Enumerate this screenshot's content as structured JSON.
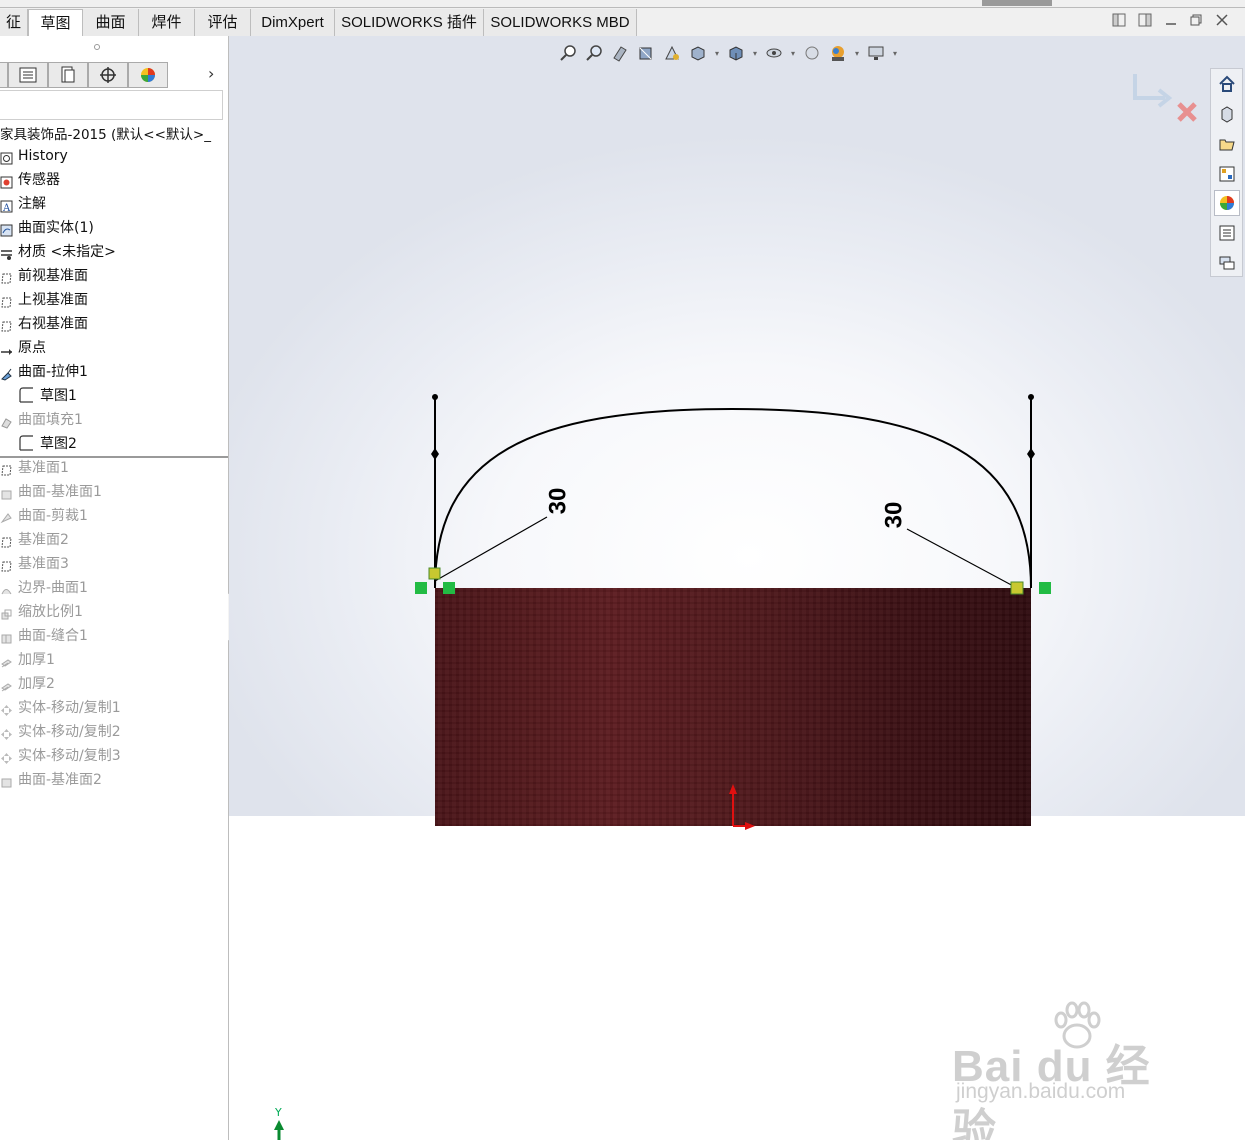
{
  "tabs": [
    {
      "label": "征",
      "active": false
    },
    {
      "label": "草图",
      "active": true
    },
    {
      "label": "曲面",
      "active": false
    },
    {
      "label": "焊件",
      "active": false
    },
    {
      "label": "评估",
      "active": false
    },
    {
      "label": "DimXpert",
      "active": false
    },
    {
      "label": "SOLIDWORKS 插件",
      "active": false
    },
    {
      "label": "SOLIDWORKS MBD",
      "active": false
    }
  ],
  "panel": {
    "root_label": "家具装饰品-2015  (默认<<默认>_",
    "tree": [
      {
        "label": "History",
        "icon": "history-icon",
        "suppressed": false,
        "indent": 0
      },
      {
        "label": "传感器",
        "icon": "sensor-icon",
        "suppressed": false,
        "indent": 0
      },
      {
        "label": "注解",
        "icon": "annotation-icon",
        "suppressed": false,
        "indent": 0
      },
      {
        "label": "曲面实体(1)",
        "icon": "surface-bodies-icon",
        "suppressed": false,
        "indent": 0
      },
      {
        "label": "材质 <未指定>",
        "icon": "material-icon",
        "suppressed": false,
        "indent": 0
      },
      {
        "label": "前视基准面",
        "icon": "plane-icon",
        "suppressed": false,
        "indent": 0
      },
      {
        "label": "上视基准面",
        "icon": "plane-icon",
        "suppressed": false,
        "indent": 0
      },
      {
        "label": "右视基准面",
        "icon": "plane-icon",
        "suppressed": false,
        "indent": 0
      },
      {
        "label": "原点",
        "icon": "origin-icon",
        "suppressed": false,
        "indent": 0
      },
      {
        "label": "曲面-拉伸1",
        "icon": "surface-extrude-icon",
        "suppressed": false,
        "indent": 0
      },
      {
        "label": "草图1",
        "icon": "sketch-icon",
        "suppressed": false,
        "indent": 1
      },
      {
        "label": "曲面填充1",
        "icon": "surface-fill-icon",
        "suppressed": true,
        "indent": 0
      },
      {
        "label": "草图2",
        "icon": "sketch-icon",
        "suppressed": false,
        "indent": 1
      },
      {
        "label": "基准面1",
        "icon": "plane-icon",
        "suppressed": true,
        "indent": 0
      },
      {
        "label": "曲面-基准面1",
        "icon": "surface-plane-icon",
        "suppressed": true,
        "indent": 0
      },
      {
        "label": "曲面-剪裁1",
        "icon": "surface-trim-icon",
        "suppressed": true,
        "indent": 0
      },
      {
        "label": "基准面2",
        "icon": "plane-icon",
        "suppressed": true,
        "indent": 0
      },
      {
        "label": "基准面3",
        "icon": "plane-icon",
        "suppressed": true,
        "indent": 0
      },
      {
        "label": "边界-曲面1",
        "icon": "boundary-surface-icon",
        "suppressed": true,
        "indent": 0
      },
      {
        "label": "缩放比例1",
        "icon": "scale-icon",
        "suppressed": true,
        "indent": 0
      },
      {
        "label": "曲面-缝合1",
        "icon": "knit-icon",
        "suppressed": true,
        "indent": 0
      },
      {
        "label": "加厚1",
        "icon": "thicken-icon",
        "suppressed": true,
        "indent": 0
      },
      {
        "label": "加厚2",
        "icon": "thicken-icon",
        "suppressed": true,
        "indent": 0
      },
      {
        "label": "实体-移动/复制1",
        "icon": "move-copy-icon",
        "suppressed": true,
        "indent": 0
      },
      {
        "label": "实体-移动/复制2",
        "icon": "move-copy-icon",
        "suppressed": true,
        "indent": 0
      },
      {
        "label": "实体-移动/复制3",
        "icon": "move-copy-icon",
        "suppressed": true,
        "indent": 0
      },
      {
        "label": "曲面-基准面2",
        "icon": "surface-plane-icon",
        "suppressed": true,
        "indent": 0
      }
    ]
  },
  "viewport": {
    "dimension_left": "30",
    "dimension_right": "30",
    "axis_label": "Y"
  },
  "watermark": {
    "brand": "Bai du 经验",
    "url": "jingyan.baidu.com"
  },
  "colors": {
    "sketch_block": "#4a1418",
    "relation_green": "#22bb44",
    "triad_red": "#e01010"
  }
}
